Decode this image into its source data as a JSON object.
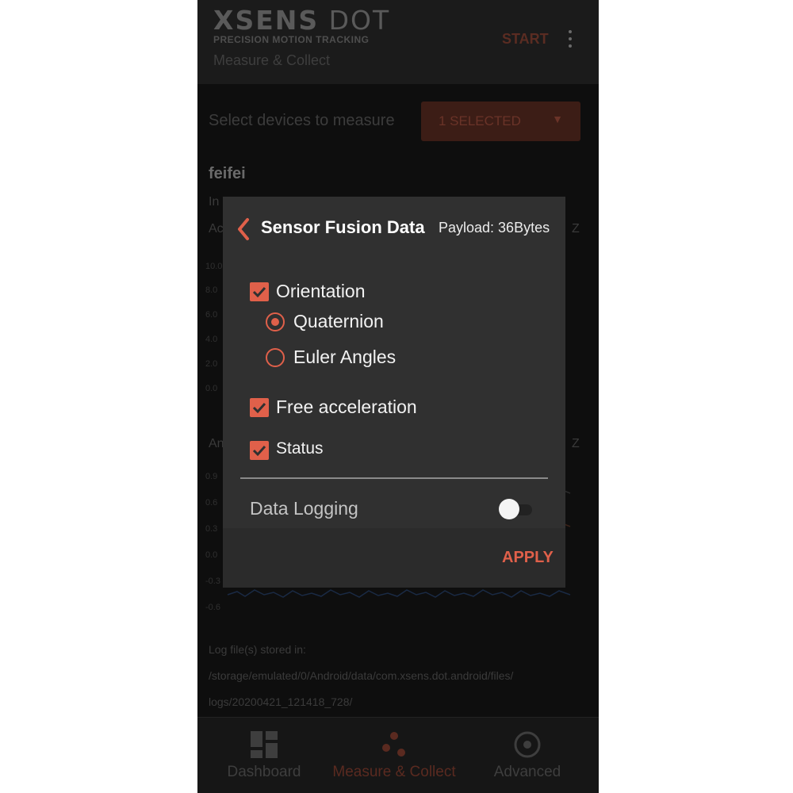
{
  "app": {
    "brand": "XSENS",
    "brand_suffix": "DOT",
    "tagline": "PRECISION MOTION TRACKING",
    "subtitle": "Measure & Collect",
    "start_label": "START",
    "menu_icon": "more-vert-icon"
  },
  "device_select": {
    "label": "Select devices to measure",
    "dropdown_value": "1 SELECTED",
    "dropdown_icon": "triangle-down-icon"
  },
  "device": {
    "name": "feifei",
    "line1_prefix": "In",
    "line2_prefix": "Ac",
    "chart1_axis_end": "Z",
    "chart2_title_prefix": "An",
    "chart2_axis_end": "Z"
  },
  "chart1_ticks": [
    "10.0",
    "8.0",
    "6.0",
    "4.0",
    "2.0",
    "0.0"
  ],
  "chart2_ticks": [
    "0.9",
    "0.6",
    "0.3",
    "0.0",
    "-0.3",
    "-0.6"
  ],
  "log": {
    "line1": "Log file(s) stored in:",
    "line2": "/storage/emulated/0/Android/data/com.xsens.dot.android/files/",
    "line3": "logs/20200421_121418_728/"
  },
  "dialog": {
    "back_icon": "chevron-left-icon",
    "title": "Sensor Fusion Data",
    "payload": "Payload: 36Bytes",
    "options": {
      "orientation": {
        "label": "Orientation",
        "checked": true
      },
      "quaternion": {
        "label": "Quaternion",
        "selected": true
      },
      "euler": {
        "label": "Euler Angles",
        "selected": false
      },
      "free_accel": {
        "label": "Free acceleration",
        "checked": true
      },
      "status": {
        "label": "Status",
        "checked": true
      }
    },
    "data_logging": {
      "label": "Data Logging",
      "enabled": false
    },
    "apply_label": "APPLY"
  },
  "bottom_nav": [
    {
      "label": "Dashboard",
      "icon": "dashboard-icon",
      "active": false
    },
    {
      "label": "Measure & Collect",
      "icon": "measure-collect-icon",
      "active": true
    },
    {
      "label": "Advanced",
      "icon": "advanced-icon",
      "active": false
    }
  ],
  "colors": {
    "accent": "#e0604a",
    "dialog_bg": "#303030",
    "screen_bg": "#0e0e0e"
  }
}
